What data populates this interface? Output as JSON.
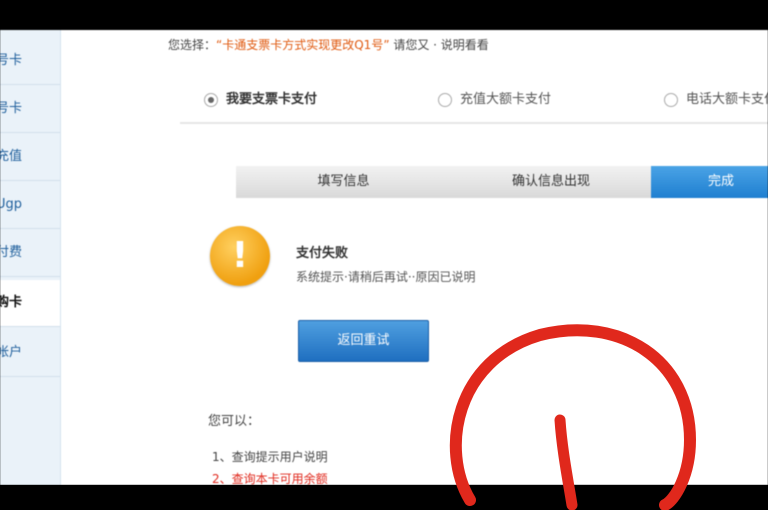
{
  "instruction": {
    "prefix": "您选择：",
    "highlight": "“卡通支票卡方式实现更改Q1号”",
    "suffix": "请您又 · 说明看看"
  },
  "radios": [
    {
      "label": "我要支票卡支付",
      "selected": true
    },
    {
      "label": "充值大额卡支付",
      "selected": false
    },
    {
      "label": "电话大额卡支付",
      "selected": false
    }
  ],
  "steps": [
    "填写信息",
    "确认信息出现",
    "完成"
  ],
  "message": {
    "title": "支付失败",
    "text": "系统提示·请稍后再试··原因已说明"
  },
  "retry_button": "返回重试",
  "help": {
    "title": "您可以：",
    "items": [
      "1、查询提示用户说明",
      "2、查询本卡可用余额"
    ]
  },
  "sidebar": [
    "号卡",
    "号卡",
    "充值",
    "Ugp",
    "付费",
    "购卡",
    "帐户"
  ],
  "colors": {
    "accent": "#1f7fd0",
    "warning": "#f0a010",
    "annotation": "#e0281c",
    "highlight": "#e05a10"
  }
}
